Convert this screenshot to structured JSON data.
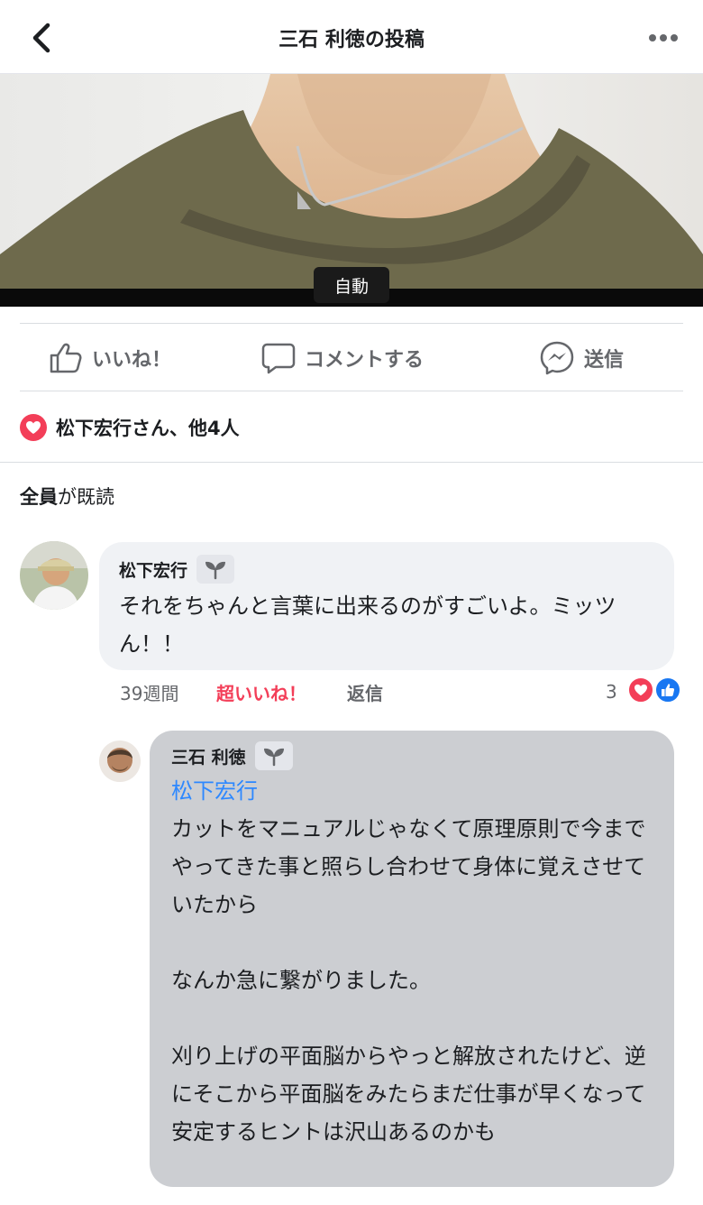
{
  "header": {
    "title": "三石 利徳の投稿",
    "back_icon": "chevron-left-icon",
    "more_icon": "more-dots-icon"
  },
  "video": {
    "auto_label": "自動"
  },
  "actions": {
    "like_label": "いいね！",
    "comment_label": "コメントする",
    "send_label": "送信"
  },
  "reactions": {
    "summary": "松下宏行さん、他4人"
  },
  "seen": {
    "bold": "全員",
    "rest": "が既読"
  },
  "comments": [
    {
      "author": "松下宏行",
      "text": "それをちゃんと言葉に出来るのがすごいよ。ミッツん！！",
      "time": "39週間",
      "reaction_label": "超いいね！",
      "reply_label": "返信",
      "reaction_count": "3"
    }
  ],
  "reply": {
    "author": "三石 利徳",
    "mention": "松下宏行",
    "text": "カットをマニュアルじゃなくて原理原則で今までやってきた事と照らし合わせて身体に覚えさせていたから\n\nなんか急に繋がりました。\n\n刈り上げの平面脳からやっと解放されたけど、逆にそこから平面脳をみたらまだ仕事が早くなって安定するヒントは沢山あるのかも"
  },
  "colors": {
    "accent_red": "#f33e58",
    "accent_blue": "#2d88ff",
    "reply_bubble": "#ccced2",
    "comment_bubble": "#f0f2f5"
  }
}
